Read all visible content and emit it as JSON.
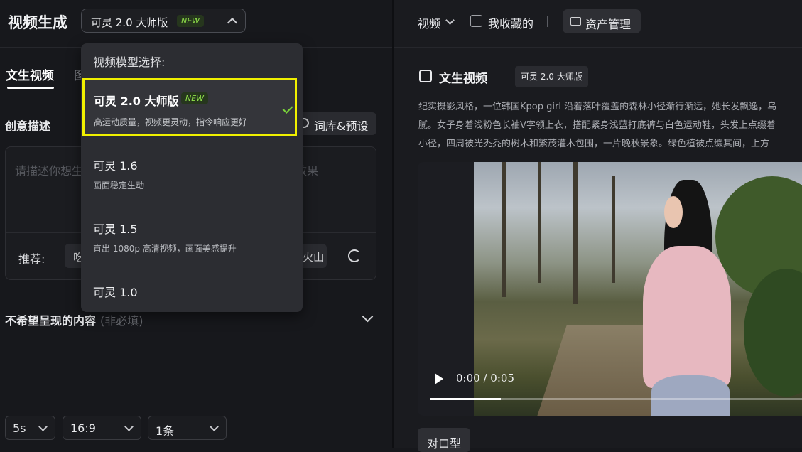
{
  "header": {
    "app_title": "视频生成",
    "model_selected": "可灵 2.0 大师版",
    "new_badge": "NEW"
  },
  "tabs": {
    "text_to_video": "文生视频",
    "image_to_video": "图"
  },
  "creative": {
    "label": "创意描述",
    "lexicon_button": "词库&预设",
    "placeholder_start": "请描述你想生",
    "placeholder_end": "效果",
    "recommend_label": "推荐:",
    "chip1": "吃",
    "chip2": "火山"
  },
  "negative": {
    "label": "不希望呈现的内容",
    "optional": "(非必填)"
  },
  "settings": {
    "duration": "5s",
    "ratio": "16:9",
    "count": "1条"
  },
  "dropdown": {
    "header": "视频模型选择:",
    "options": [
      {
        "name": "可灵 2.0 大师版",
        "badge": "NEW",
        "desc": "高运动质量，视频更灵动，指令响应更好",
        "selected": true
      },
      {
        "name": "可灵 1.6",
        "desc": "画面稳定生动"
      },
      {
        "name": "可灵 1.5",
        "desc": "直出 1080p 高清视频，画面美感提升"
      },
      {
        "name": "可灵 1.0",
        "desc": ""
      }
    ]
  },
  "right": {
    "video_menu": "视频",
    "favorites": "我收藏的",
    "separator": "|",
    "asset_button": "资产管理",
    "section_title": "文生视频",
    "model_tag": "可灵 2.0 大师版",
    "description_lines": [
      "纪实摄影风格，一位韩国Kpop girl 沿着落叶覆盖的森林小径渐行渐远，她长发飘逸，乌",
      "腻。女子身着浅粉色长袖V字领上衣，搭配紧身浅蓝打底裤与白色运动鞋，头发上点缀着",
      "小径，四周被光秃秃的树木和繁茂灌木包围，一片晚秋景象。绿色植被点缀其间，上方"
    ],
    "time": "0:00 / 0:05",
    "progress_fraction": 0.19,
    "lip_sync_button": "对口型"
  },
  "colors": {
    "accent_new": "#8fe04a",
    "highlight": "#f0f000",
    "check": "#7ad33a"
  }
}
